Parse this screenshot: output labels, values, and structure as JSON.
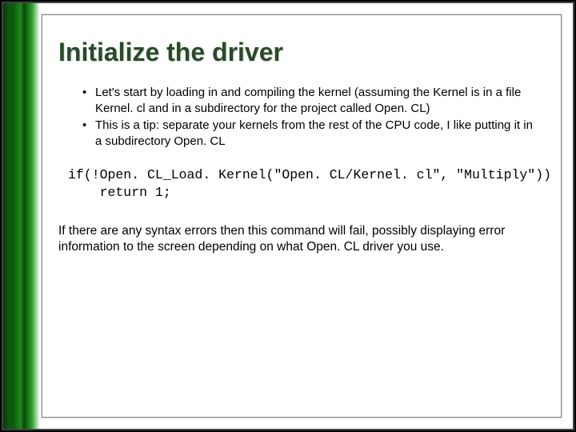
{
  "title": "Initialize the driver",
  "bullets": [
    "Let's start by loading in and compiling the kernel (assuming the Kernel is in a file Kernel. cl and in a subdirectory for the project called Open. CL)",
    "This is a tip: separate your kernels from the rest of the CPU code, I like putting it in a subdirectory Open. CL"
  ],
  "code": "if(!Open. CL_Load. Kernel(\"Open. CL/Kernel. cl\", \"Multiply\"))\n    return 1;",
  "paragraph": "If there are any syntax errors then this command will fail, possibly displaying error information to the screen depending on what Open. CL driver you use."
}
